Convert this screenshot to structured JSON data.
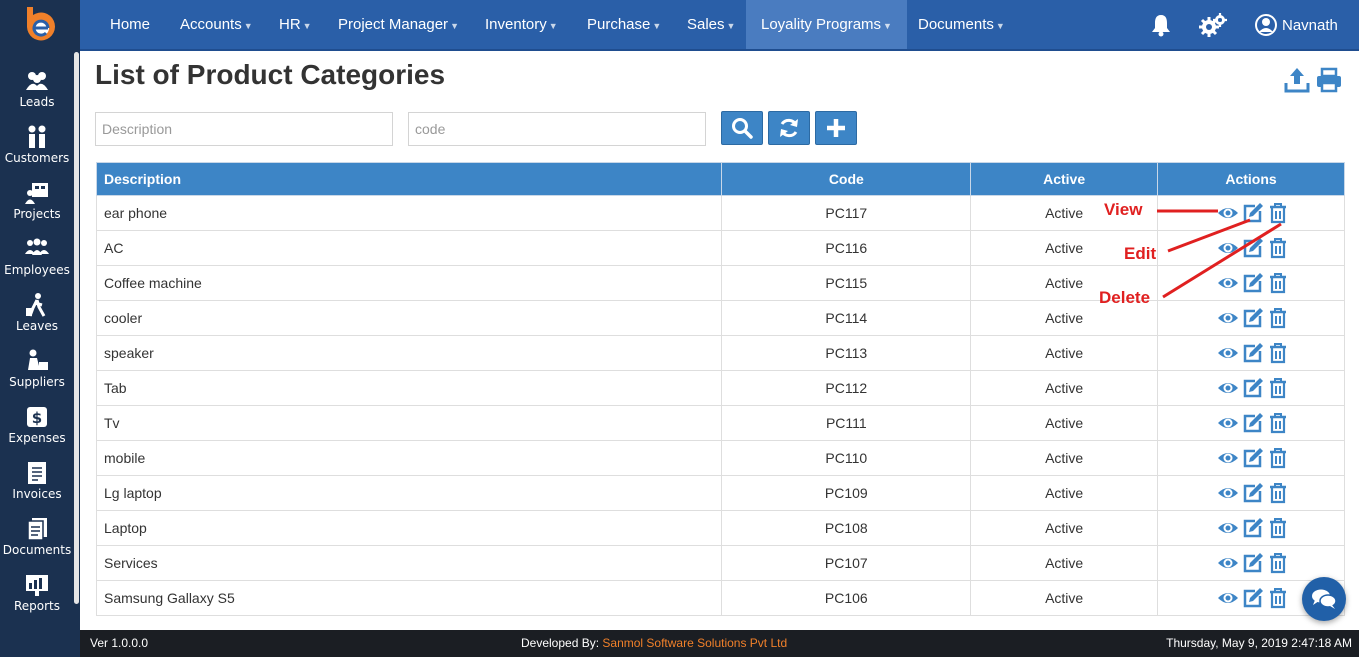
{
  "nav": {
    "items": [
      {
        "label": "Home"
      },
      {
        "label": "Accounts"
      },
      {
        "label": "HR"
      },
      {
        "label": "Project Manager"
      },
      {
        "label": "Inventory"
      },
      {
        "label": "Purchase"
      },
      {
        "label": "Sales"
      },
      {
        "label": "Loyality Programs"
      },
      {
        "label": "Documents"
      }
    ],
    "active": "Loyality Programs",
    "user_name": "Navnath",
    "icons": [
      "bell-icon",
      "gears-icon",
      "user-circle-icon"
    ]
  },
  "sidebar": {
    "logo": "e-logo",
    "items": [
      {
        "label": "Leads",
        "icon": "leads-icon"
      },
      {
        "label": "Customers",
        "icon": "customers-icon"
      },
      {
        "label": "Projects",
        "icon": "projects-icon"
      },
      {
        "label": "Employees",
        "icon": "employees-icon"
      },
      {
        "label": "Leaves",
        "icon": "leaves-icon"
      },
      {
        "label": "Suppliers",
        "icon": "suppliers-icon"
      },
      {
        "label": "Expenses",
        "icon": "expenses-icon"
      },
      {
        "label": "Invoices",
        "icon": "invoices-icon"
      },
      {
        "label": "Documents",
        "icon": "documents-icon"
      },
      {
        "label": "Reports",
        "icon": "reports-icon"
      }
    ]
  },
  "page": {
    "title": "List of Product Categories"
  },
  "filters": {
    "description_placeholder": "Description",
    "description_value": "",
    "code_placeholder": "code",
    "code_value": ""
  },
  "table": {
    "headers": {
      "description": "Description",
      "code": "Code",
      "active": "Active",
      "actions": "Actions"
    },
    "rows": [
      {
        "description": "ear phone",
        "code": "PC117",
        "active": "Active"
      },
      {
        "description": "AC",
        "code": "PC116",
        "active": "Active"
      },
      {
        "description": "Coffee machine",
        "code": "PC115",
        "active": "Active"
      },
      {
        "description": "cooler",
        "code": "PC114",
        "active": "Active"
      },
      {
        "description": "speaker",
        "code": "PC113",
        "active": "Active"
      },
      {
        "description": "Tab",
        "code": "PC112",
        "active": "Active"
      },
      {
        "description": "Tv",
        "code": "PC111",
        "active": "Active"
      },
      {
        "description": "mobile",
        "code": "PC110",
        "active": "Active"
      },
      {
        "description": "Lg laptop",
        "code": "PC109",
        "active": "Active"
      },
      {
        "description": "Laptop",
        "code": "PC108",
        "active": "Active"
      },
      {
        "description": "Services",
        "code": "PC107",
        "active": "Active"
      },
      {
        "description": "Samsung Gallaxy S5",
        "code": "PC106",
        "active": "Active"
      }
    ]
  },
  "annotations": {
    "view": "View",
    "edit": "Edit",
    "delete": "Delete"
  },
  "footer": {
    "version": "Ver 1.0.0.0",
    "developed_by": "Developed By: ",
    "company": "Sanmol Software Solutions Pvt Ltd",
    "datetime": "Thursday, May 9, 2019 2:47:18 AM"
  },
  "colors": {
    "nav_bg": "#2a5fa8",
    "sidebar_bg": "#1b3150",
    "table_header": "#3d85c6",
    "icon_blue": "#3d85c6",
    "annotation": "#e02020",
    "footer_bg": "#1b1e23",
    "footer_accent": "#f0802a"
  }
}
